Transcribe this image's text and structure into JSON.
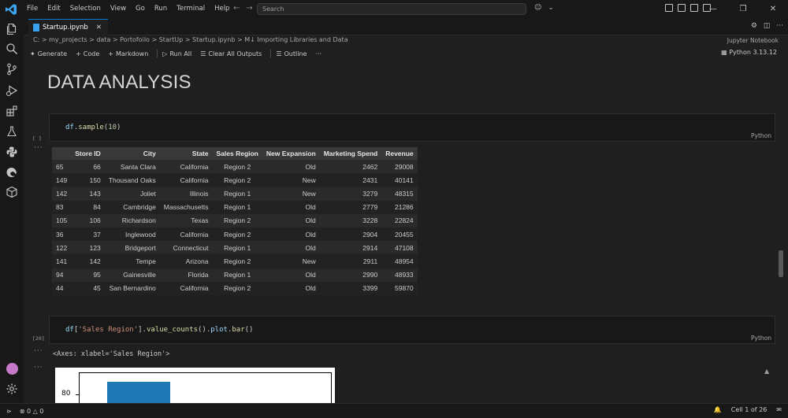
{
  "menu": [
    "File",
    "Edit",
    "Selection",
    "View",
    "Go",
    "Run",
    "Terminal",
    "Help"
  ],
  "search": {
    "placeholder": "Search"
  },
  "tab": {
    "filename": "Startup.ipynb"
  },
  "breadcrumb": "C: > my_projects > data > Portofoilo > StartUp > Startup.ipynb > M↓ Importing Libraries and Data",
  "kernel_label": "Jupyter Notebook",
  "toolbar": {
    "generate": "Generate",
    "code": "Code",
    "markdown": "Markdown",
    "run_all": "Run All",
    "clear_outputs": "Clear All Outputs",
    "outline": "Outline",
    "more": "···"
  },
  "kernel_version": "Python 3.13.12",
  "heading": "DATA ANALYSIS",
  "cells": [
    {
      "exec": "[ ]",
      "lang": "Python"
    },
    {
      "exec": "[20]",
      "lang": "Python"
    }
  ],
  "dataframe": {
    "columns": [
      "",
      "Store ID",
      "City",
      "State",
      "Sales Region",
      "New Expansion",
      "Marketing Spend",
      "Revenue"
    ],
    "rows": [
      [
        "65",
        "66",
        "Santa Clara",
        "California",
        "Region 2",
        "Old",
        "2462",
        "29008"
      ],
      [
        "149",
        "150",
        "Thousand Oaks",
        "California",
        "Region 2",
        "New",
        "2431",
        "40141"
      ],
      [
        "142",
        "143",
        "Joliet",
        "Illinois",
        "Region 1",
        "New",
        "3279",
        "48315"
      ],
      [
        "83",
        "84",
        "Cambridge",
        "Massachusetts",
        "Region 1",
        "Old",
        "2779",
        "21286"
      ],
      [
        "105",
        "106",
        "Richardson",
        "Texas",
        "Region 2",
        "Old",
        "3228",
        "22824"
      ],
      [
        "36",
        "37",
        "Inglewood",
        "California",
        "Region 2",
        "Old",
        "2904",
        "20455"
      ],
      [
        "122",
        "123",
        "Bridgeport",
        "Connecticut",
        "Region 1",
        "Old",
        "2914",
        "47108"
      ],
      [
        "141",
        "142",
        "Tempe",
        "Arizona",
        "Region 2",
        "New",
        "2911",
        "48954"
      ],
      [
        "94",
        "95",
        "Gainesville",
        "Florida",
        "Region 1",
        "Old",
        "2990",
        "48933"
      ],
      [
        "44",
        "45",
        "San Bernardino",
        "California",
        "Region 2",
        "Old",
        "3399",
        "59870"
      ]
    ]
  },
  "axes_output": "<Axes: xlabel='Sales Region'>",
  "plot": {
    "ytick": "80"
  },
  "status": {
    "errors": "0",
    "warnings": "0",
    "cell_position": "Cell 1 of 26"
  },
  "colors": {
    "accent": "#0078d4",
    "bar": "#1f77b4"
  }
}
